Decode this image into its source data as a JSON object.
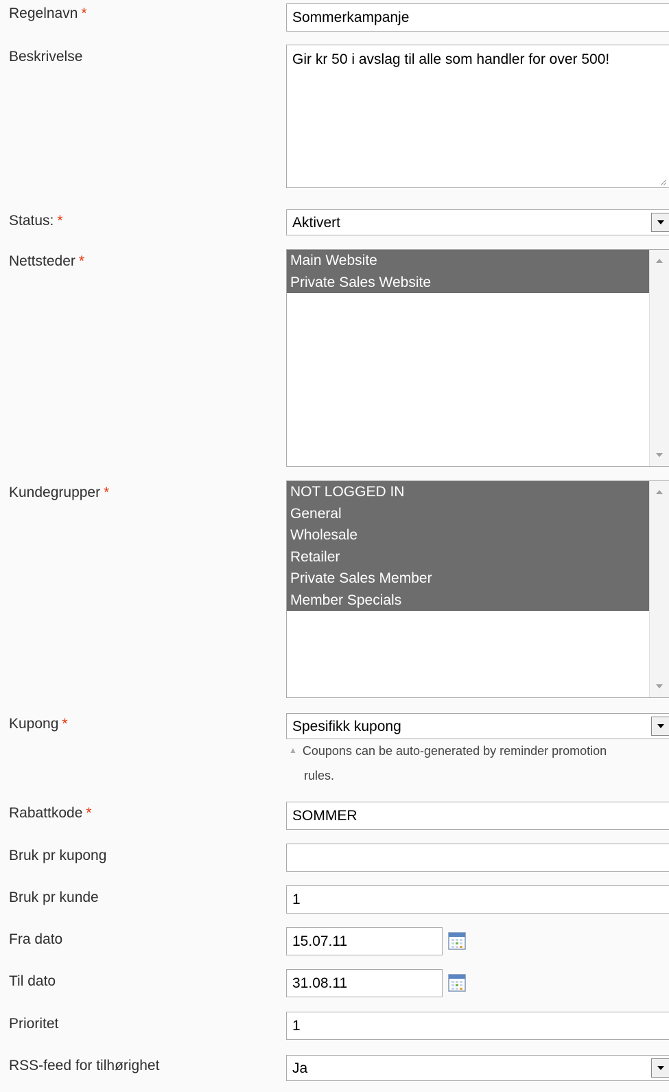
{
  "fields": {
    "rule_name": {
      "label": "Regelnavn",
      "value": "Sommerkampanje"
    },
    "description": {
      "label": "Beskrivelse",
      "value": "Gir kr 50 i avslag til alle som handler for over 500!"
    },
    "status": {
      "label": "Status:",
      "value": "Aktivert"
    },
    "websites": {
      "label": "Nettsteder",
      "options": [
        "Main Website",
        "Private Sales Website"
      ]
    },
    "customer_groups": {
      "label": "Kundegrupper",
      "options": [
        "NOT LOGGED IN",
        "General",
        "Wholesale",
        "Retailer",
        "Private Sales Member",
        "Member Specials"
      ]
    },
    "coupon": {
      "label": "Kupong",
      "value": "Spesifikk kupong",
      "note_line1": "Coupons can be auto-generated by reminder promotion",
      "note_line2": "rules."
    },
    "coupon_code": {
      "label": "Rabattkode",
      "value": "SOMMER"
    },
    "uses_per_coupon": {
      "label": "Bruk pr kupong",
      "value": ""
    },
    "uses_per_customer": {
      "label": "Bruk pr kunde",
      "value": "1"
    },
    "from_date": {
      "label": "Fra dato",
      "value": "15.07.11"
    },
    "to_date": {
      "label": "Til dato",
      "value": "31.08.11"
    },
    "priority": {
      "label": "Prioritet",
      "value": "1"
    },
    "rss_feed": {
      "label": "RSS-feed for tilhørighet",
      "value": "Ja"
    }
  },
  "required_marker": "*",
  "icons": {
    "calendar": "calendar-icon",
    "dropdown": "chevron-down-icon",
    "note": "triangle-up-icon"
  },
  "colors": {
    "required": "#eb340a",
    "selected_option_bg": "#6d6d6d"
  }
}
